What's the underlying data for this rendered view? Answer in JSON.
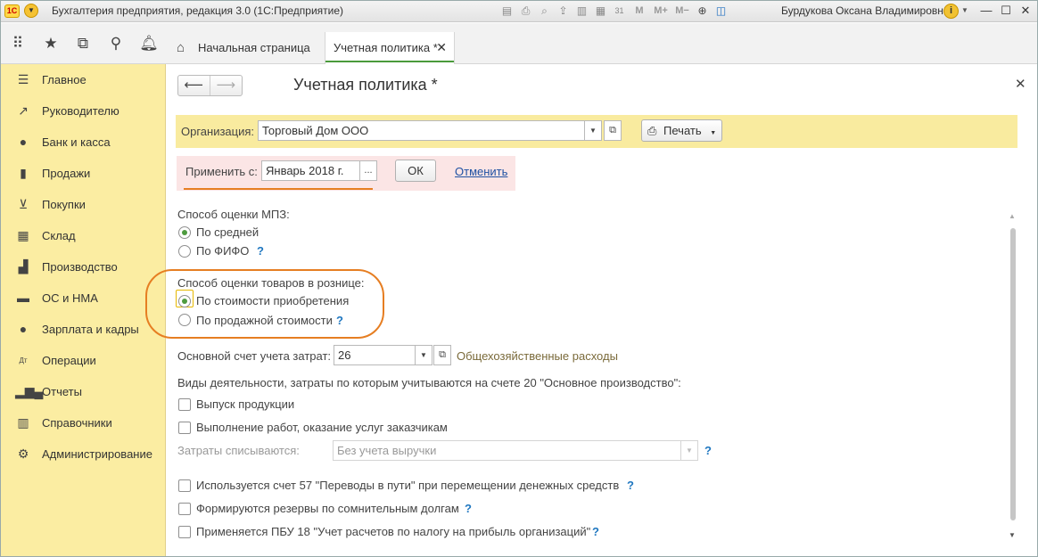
{
  "titlebar": {
    "logo": "1С",
    "title": "Бухгалтерия предприятия, редакция 3.0  (1С:Предприятие)",
    "user": "Бурдукова Оксана Владимировна",
    "mem_buttons": [
      "M",
      "M+",
      "M−"
    ],
    "calendar_day": "31"
  },
  "tabs": {
    "home": "Начальная страница",
    "active": "Учетная политика *"
  },
  "sidebar": {
    "items": [
      {
        "label": "Главное",
        "icon": "menu-lines-icon"
      },
      {
        "label": "Руководителю",
        "icon": "trend-icon"
      },
      {
        "label": "Банк и касса",
        "icon": "ruble-icon"
      },
      {
        "label": "Продажи",
        "icon": "bag-icon"
      },
      {
        "label": "Покупки",
        "icon": "cart-icon"
      },
      {
        "label": "Склад",
        "icon": "warehouse-icon"
      },
      {
        "label": "Производство",
        "icon": "factory-icon"
      },
      {
        "label": "ОС и НМА",
        "icon": "truck-icon"
      },
      {
        "label": "Зарплата и кадры",
        "icon": "person-icon"
      },
      {
        "label": "Операции",
        "icon": "dt-kt-icon"
      },
      {
        "label": "Отчеты",
        "icon": "bar-chart-icon"
      },
      {
        "label": "Справочники",
        "icon": "book-icon"
      },
      {
        "label": "Администрирование",
        "icon": "gear-icon"
      }
    ]
  },
  "form": {
    "title": "Учетная политика *",
    "org_label": "Организация:",
    "org_value": "Торговый Дом ООО",
    "print_label": "Печать",
    "apply_label": "Применить с:",
    "apply_value": "Январь 2018 г.",
    "apply_ellipsis": "...",
    "ok_label": "ОК",
    "cancel_label": "Отменить",
    "mpz_label": "Способ оценки МПЗ:",
    "mpz_options": [
      "По средней",
      "По ФИФО"
    ],
    "mpz_selected": 0,
    "retail_label": "Способ оценки товаров в рознице:",
    "retail_options": [
      "По стоимости приобретения",
      "По продажной стоимости"
    ],
    "retail_selected": 0,
    "cost_account_label": "Основной счет учета затрат:",
    "cost_account_value": "26",
    "cost_account_desc": "Общехозяйственные расходы",
    "activities_label": "Виды деятельности, затраты по которым учитываются на счете 20 \"Основное производство\":",
    "activities": [
      "Выпуск продукции",
      "Выполнение работ, оказание услуг заказчикам"
    ],
    "writeoff_label": "Затраты списываются:",
    "writeoff_value": "Без учета выручки",
    "flags": [
      "Используется счет 57 \"Переводы в пути\" при перемещении денежных средств",
      "Формируются резервы по сомнительным долгам",
      "Применяется ПБУ 18 \"Учет расчетов по налогу на прибыль организаций\""
    ],
    "help_mark": "?"
  },
  "colors": {
    "sidebar_bg": "#fbeda2",
    "accent_green": "#4a9a3b",
    "highlight_orange": "#e67e22",
    "link_blue": "#1f51a3"
  }
}
